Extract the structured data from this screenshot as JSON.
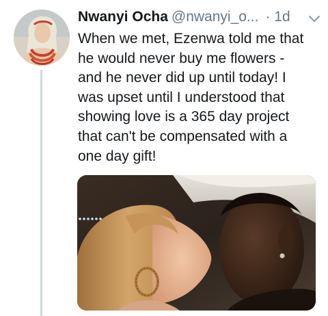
{
  "tweet": {
    "author": {
      "display_name": "Nwanyi Ocha",
      "handle": "@nwanyi_o...",
      "avatar_icon": "profile-photo-avatar"
    },
    "separator": "·",
    "timestamp": "1d",
    "more_icon": "chevron-down-icon",
    "lines": [
      "When we met, Ezenwa told me that",
      "he would never buy me flowers -",
      "and he never did up until today! I",
      "was upset until I understood that",
      "showing love is a 365 day project",
      "that can't be compensated with a",
      "one day gift!"
    ],
    "media": {
      "type": "photo"
    }
  },
  "colors": {
    "text_primary": "#14171a",
    "text_secondary": "#657786",
    "thread_line": "#cfd9de"
  }
}
